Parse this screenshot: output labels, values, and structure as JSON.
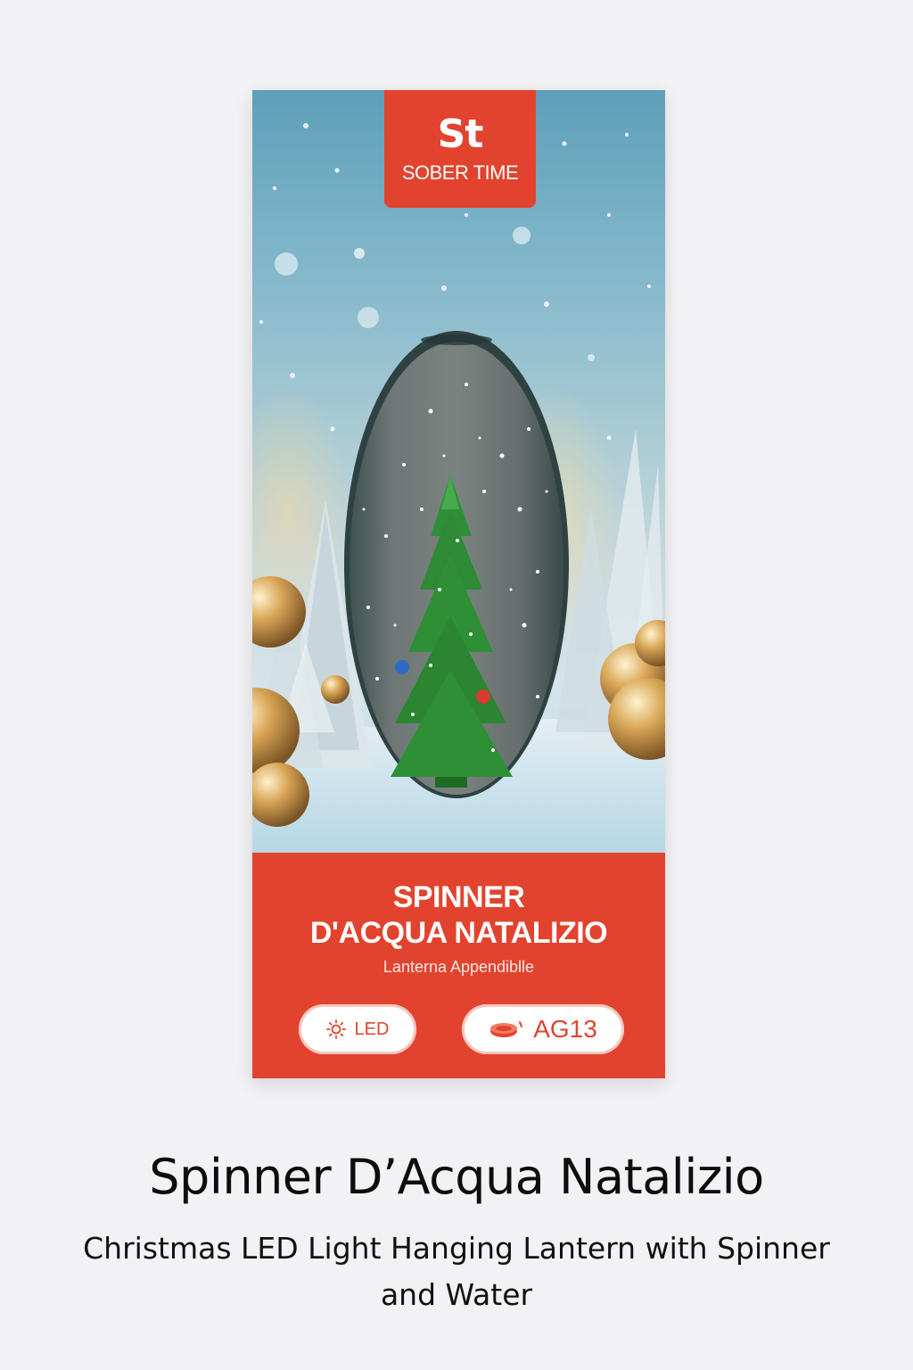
{
  "brand": {
    "logo_mark": "St",
    "name": "SOBER TIME",
    "color": "#e2432e"
  },
  "package": {
    "title_line1": "SPINNER",
    "title_line2": "D'ACQUA NATALIZIO",
    "subtitle": "Lanterna Appendiblle",
    "badges": [
      {
        "icon": "sun-icon",
        "label": "LED"
      },
      {
        "icon": "battery-icon",
        "label": "AG13"
      }
    ]
  },
  "caption": {
    "title": "Spinner D’Acqua Natalizio",
    "subtitle": "Christmas LED Light Hanging Lantern with Spinner and Water"
  },
  "colors": {
    "background": "#f2f1f3",
    "tree": "#2f8f36"
  }
}
